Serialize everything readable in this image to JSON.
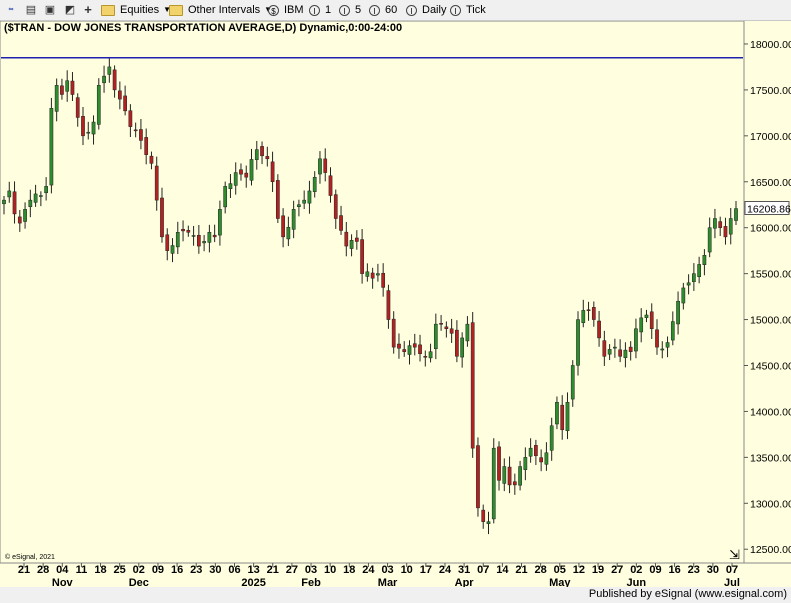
{
  "toolbar": {
    "equities_label": "Equities",
    "other_intervals_label": "Other Intervals",
    "symbol_label": "IBM",
    "interval_1": "1",
    "interval_5": "5",
    "interval_60": "60",
    "daily_label": "Daily",
    "tick_label": "Tick"
  },
  "chart_data": {
    "type": "candlestick",
    "title": "($TRAN - DOW JONES TRANSPORTATION AVERAGE,D) Dynamic,0:00-24:00",
    "copyright": "© eSignal, 2021",
    "last_price": "16208.86",
    "ylim": [
      12350,
      18250
    ],
    "y_ticks": [
      "12500.00",
      "13000.00",
      "13500.00",
      "14000.00",
      "14500.00",
      "15000.00",
      "15500.00",
      "16000.00",
      "16500.00",
      "17000.00",
      "17500.00",
      "18000.00"
    ],
    "horizontal_line": 17850,
    "x_day_labels": [
      "21",
      "28",
      "04",
      "11",
      "18",
      "25",
      "02",
      "09",
      "16",
      "23",
      "30",
      "06",
      "13",
      "21",
      "27",
      "03",
      "10",
      "18",
      "24",
      "03",
      "10",
      "17",
      "24",
      "31",
      "07",
      "14",
      "21",
      "28",
      "05",
      "12",
      "19",
      "27",
      "02",
      "09",
      "16",
      "23",
      "30",
      "07"
    ],
    "x_month_labels": [
      {
        "label": "Nov",
        "at": "04"
      },
      {
        "label": "Dec",
        "at": "02"
      },
      {
        "label": "2025",
        "at": "13"
      },
      {
        "label": "Feb",
        "at": "03"
      },
      {
        "label": "Mar",
        "at": "03"
      },
      {
        "label": "Apr",
        "at": "31"
      },
      {
        "label": "May",
        "at": "05"
      },
      {
        "label": "Jun",
        "at": "02"
      },
      {
        "label": "Jul",
        "at": "07"
      }
    ],
    "colors": {
      "up": "#2e8b2e",
      "down": "#b22222",
      "background": "#ffffe0",
      "hline": "#2020b0"
    },
    "anchors": [
      [
        0,
        16300
      ],
      [
        1,
        16400
      ],
      [
        2,
        16150
      ],
      [
        3,
        16050
      ],
      [
        4,
        16200
      ],
      [
        5,
        16300
      ],
      [
        7,
        16350
      ],
      [
        8,
        16450
      ],
      [
        9,
        17300
      ],
      [
        10,
        17550
      ],
      [
        11,
        17450
      ],
      [
        12,
        17600
      ],
      [
        13,
        17450
      ],
      [
        14,
        17200
      ],
      [
        15,
        17000
      ],
      [
        17,
        17150
      ],
      [
        18,
        17550
      ],
      [
        19,
        17650
      ],
      [
        20,
        17750
      ],
      [
        21,
        17500
      ],
      [
        22,
        17400
      ],
      [
        24,
        17100
      ],
      [
        26,
        16950
      ],
      [
        28,
        16700
      ],
      [
        29,
        16300
      ],
      [
        30,
        15900
      ],
      [
        31,
        15750
      ],
      [
        33,
        15950
      ],
      [
        35,
        15950
      ],
      [
        37,
        15800
      ],
      [
        39,
        15950
      ],
      [
        40,
        15900
      ],
      [
        41,
        16200
      ],
      [
        42,
        16450
      ],
      [
        44,
        16600
      ],
      [
        46,
        16550
      ],
      [
        48,
        16850
      ],
      [
        50,
        16750
      ],
      [
        51,
        16500
      ],
      [
        52,
        16100
      ],
      [
        53,
        15900
      ],
      [
        55,
        16200
      ],
      [
        57,
        16300
      ],
      [
        58,
        16400
      ],
      [
        60,
        16750
      ],
      [
        61,
        16600
      ],
      [
        62,
        16350
      ],
      [
        63,
        16100
      ],
      [
        65,
        15800
      ],
      [
        67,
        15850
      ],
      [
        68,
        15500
      ],
      [
        70,
        15450
      ],
      [
        71,
        15500
      ],
      [
        72,
        15350
      ],
      [
        73,
        15000
      ],
      [
        74,
        14700
      ],
      [
        76,
        14650
      ],
      [
        78,
        14700
      ],
      [
        80,
        14600
      ],
      [
        81,
        14650
      ],
      [
        82,
        14950
      ],
      [
        84,
        14900
      ],
      [
        85,
        14850
      ],
      [
        86,
        14600
      ],
      [
        87,
        14800
      ],
      [
        88,
        14950
      ],
      [
        89,
        13600
      ],
      [
        90,
        12950
      ],
      [
        91,
        12800
      ],
      [
        92,
        12800
      ],
      [
        93,
        13600
      ],
      [
        94,
        13250
      ],
      [
        95,
        13400
      ],
      [
        96,
        13200
      ],
      [
        97,
        13200
      ],
      [
        98,
        13400
      ],
      [
        99,
        13500
      ],
      [
        100,
        13600
      ],
      [
        102,
        13450
      ],
      [
        103,
        13550
      ],
      [
        105,
        14100
      ],
      [
        106,
        13800
      ],
      [
        107,
        14100
      ],
      [
        108,
        14500
      ],
      [
        109,
        15000
      ],
      [
        110,
        15100
      ],
      [
        111,
        15100
      ],
      [
        112,
        15000
      ],
      [
        113,
        14800
      ],
      [
        114,
        14600
      ],
      [
        116,
        14700
      ],
      [
        117,
        14600
      ],
      [
        119,
        14650
      ],
      [
        120,
        14900
      ],
      [
        122,
        15050
      ],
      [
        123,
        14900
      ],
      [
        124,
        14700
      ],
      [
        126,
        14750
      ],
      [
        128,
        15200
      ],
      [
        130,
        15400
      ],
      [
        131,
        15500
      ],
      [
        132,
        15600
      ],
      [
        133,
        15700
      ],
      [
        134,
        16000
      ],
      [
        135,
        16100
      ],
      [
        136,
        16000
      ],
      [
        137,
        15900
      ],
      [
        138,
        16100
      ],
      [
        139,
        16208
      ]
    ]
  }
}
